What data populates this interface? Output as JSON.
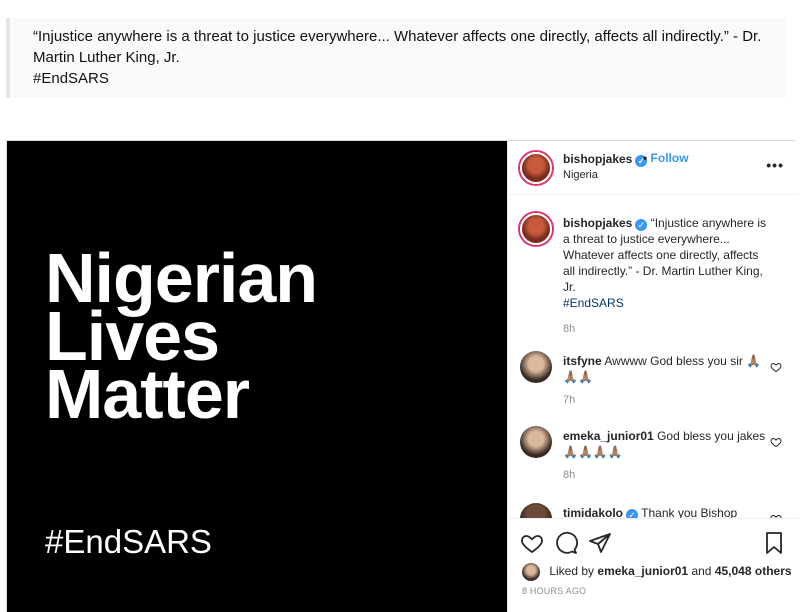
{
  "quote": {
    "text": "“Injustice anywhere is a threat to justice everywhere... Whatever affects one directly, affects all indirectly.” - Dr. Martin Luther King, Jr.",
    "hashtag": "#EndSARS"
  },
  "media": {
    "line1": "Nigerian",
    "line2": "Lives",
    "line3": "Matter",
    "hashtag": "#EndSARS",
    "background": "#000000",
    "text_color": "#ffffff"
  },
  "header": {
    "username": "bishopjakes",
    "verified_icon": "verified-badge-icon",
    "separator": "•",
    "follow_label": "Follow",
    "location": "Nigeria",
    "more_icon": "more-options-icon"
  },
  "caption": {
    "username": "bishopjakes",
    "text": "“Injustice anywhere is a threat to justice everywhere... Whatever affects one directly, affects all indirectly.” - Dr. Martin Luther King, Jr.",
    "hashtag": "#EndSARS",
    "time": "8h"
  },
  "comments": [
    {
      "username": "itsfyne",
      "text": "Awwww God bless you sir 🙏🏽🙏🏽🙏🏽",
      "time": "7h"
    },
    {
      "username": "emeka_junior01",
      "text": "God bless you jakes 🙏🏽🙏🏽🙏🏽🙏🏽",
      "time": "8h"
    },
    {
      "username": "timidakolo",
      "text": "Thank you Bishop"
    }
  ],
  "actions": {
    "like_icon": "heart-icon",
    "comment_icon": "comment-icon",
    "share_icon": "share-icon",
    "save_icon": "bookmark-icon"
  },
  "likes": {
    "prefix": "Liked by",
    "user": "emeka_junior01",
    "middle": "and",
    "count": "45,048 others"
  },
  "posted": "8 HOURS AGO",
  "colors": {
    "accent_blue": "#3897f0",
    "hashtag_blue": "#00376b",
    "muted": "#8e8e8e",
    "story_ring": "#e1306c"
  }
}
